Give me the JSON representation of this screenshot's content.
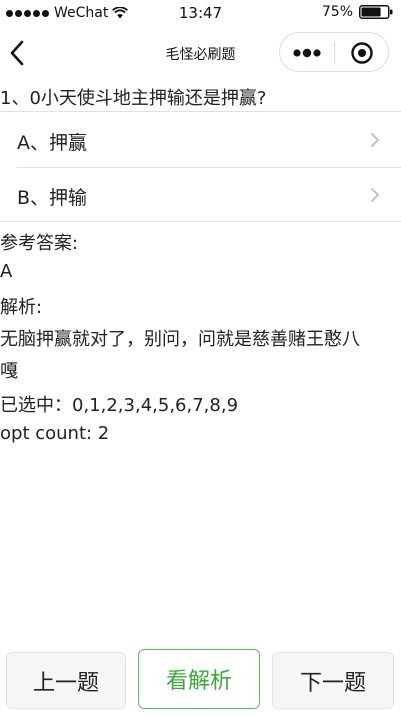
{
  "status_bar": {
    "carrier": "WeChat",
    "time": "13:47",
    "battery_percent": "75%",
    "battery_level": 0.75
  },
  "nav": {
    "title": "毛怪必刷题"
  },
  "question": {
    "text": "1、0小天使斗地主押输还是押赢?"
  },
  "options": [
    {
      "label": "A、押赢"
    },
    {
      "label": "B、押输"
    }
  ],
  "answer": {
    "heading": "参考答案:",
    "value": "A"
  },
  "analysis": {
    "heading": "解析:",
    "line1": "无脑押赢就对了，别问，问就是慈善赌王憨八",
    "line2": "嘎"
  },
  "selection": {
    "selected": "已选中：0,1,2,3,4,5,6,7,8,9",
    "opt_count": "opt count: 2"
  },
  "buttons": {
    "prev": "上一题",
    "analysis": "看解析",
    "next": "下一题"
  },
  "colors": {
    "accent_green": "#3aaa3a"
  }
}
